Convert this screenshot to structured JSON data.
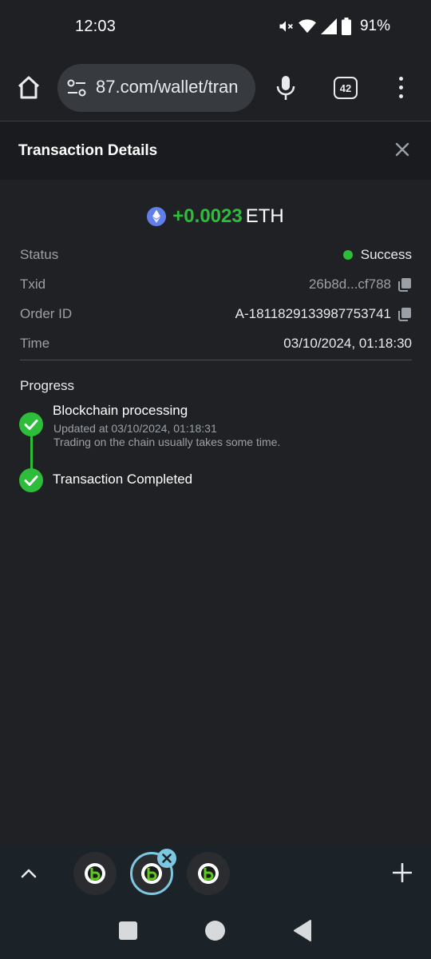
{
  "status_bar": {
    "time": "12:03",
    "battery": "91%",
    "icons": [
      "mute-icon",
      "wifi-icon",
      "signal-icon",
      "battery-icon"
    ]
  },
  "browser": {
    "url": "87.com/wallet/tran",
    "tab_count": "42",
    "icons": [
      "home-icon",
      "site-settings-icon",
      "mic-icon",
      "tabs-icon",
      "menu-icon"
    ]
  },
  "header": {
    "title": "Transaction Details"
  },
  "transaction": {
    "amount": "+0.0023",
    "unit": "ETH",
    "rows": {
      "status": {
        "label": "Status",
        "value": "Success"
      },
      "txid": {
        "label": "Txid",
        "value": "26b8d...cf788"
      },
      "order_id": {
        "label": "Order ID",
        "value": "A-1811829133987753741"
      },
      "time": {
        "label": "Time",
        "value": "03/10/2024, 01:18:30"
      }
    }
  },
  "progress": {
    "title": "Progress",
    "steps": [
      {
        "title": "Blockchain processing",
        "updated": "Updated at 03/10/2024, 01:18:31",
        "note": "Trading on the chain usually takes some time."
      },
      {
        "title": "Transaction Completed"
      }
    ]
  },
  "colors": {
    "accent_green": "#2ebd3a",
    "background": "#202124",
    "header_bg": "#1a1b1e",
    "tab_highlight": "#7cc8e0"
  }
}
